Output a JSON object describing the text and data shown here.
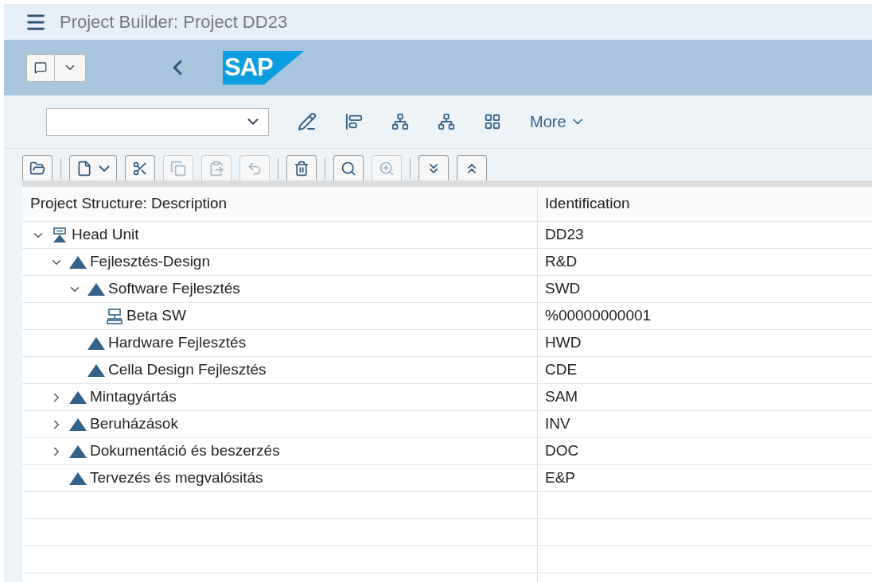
{
  "window": {
    "title": "Project Builder: Project DD23"
  },
  "header": {
    "logo": "SAP"
  },
  "toolbar": {
    "more": "More"
  },
  "tool_groups": [
    [
      {
        "disabled": false,
        "has_menu": false
      }
    ],
    [
      {
        "disabled": false,
        "has_menu": true
      },
      {
        "disabled": false,
        "has_menu": false
      },
      {
        "disabled": true,
        "has_menu": false
      },
      {
        "disabled": true,
        "has_menu": false
      },
      {
        "disabled": true,
        "has_menu": false
      }
    ],
    [
      {
        "disabled": false,
        "has_menu": false
      }
    ],
    [
      {
        "disabled": false,
        "has_menu": false
      },
      {
        "disabled": true,
        "has_menu": false
      }
    ],
    [
      {
        "disabled": false,
        "has_menu": false
      },
      {
        "disabled": false,
        "has_menu": false
      }
    ]
  ],
  "table": {
    "columns": [
      "Project Structure: Description",
      "Identification"
    ],
    "rows": [
      {
        "description": "Head Unit",
        "identification": "DD23",
        "kind": "project",
        "expanded": true,
        "children": [
          {
            "description": "Fejlesztés-Design",
            "identification": "R&D",
            "kind": "wbs",
            "expanded": true,
            "children": [
              {
                "description": "Software Fejlesztés",
                "identification": "SWD",
                "kind": "wbs",
                "expanded": true,
                "children": [
                  {
                    "description": "Beta SW",
                    "identification": "%00000000001",
                    "kind": "activity"
                  }
                ]
              },
              {
                "description": "Hardware Fejlesztés",
                "identification": "HWD",
                "kind": "wbs"
              },
              {
                "description": "Cella Design Fejlesztés",
                "identification": "CDE",
                "kind": "wbs"
              }
            ]
          },
          {
            "description": "Mintagyártás",
            "identification": "SAM",
            "kind": "wbs",
            "expanded": false
          },
          {
            "description": "Beruházások",
            "identification": "INV",
            "kind": "wbs",
            "expanded": false
          },
          {
            "description": "Dokumentáció és beszerzés",
            "identification": "DOC",
            "kind": "wbs",
            "expanded": false
          },
          {
            "description": "Tervezés és megvalósitás",
            "identification": "E&P",
            "kind": "wbs"
          }
        ]
      }
    ]
  }
}
